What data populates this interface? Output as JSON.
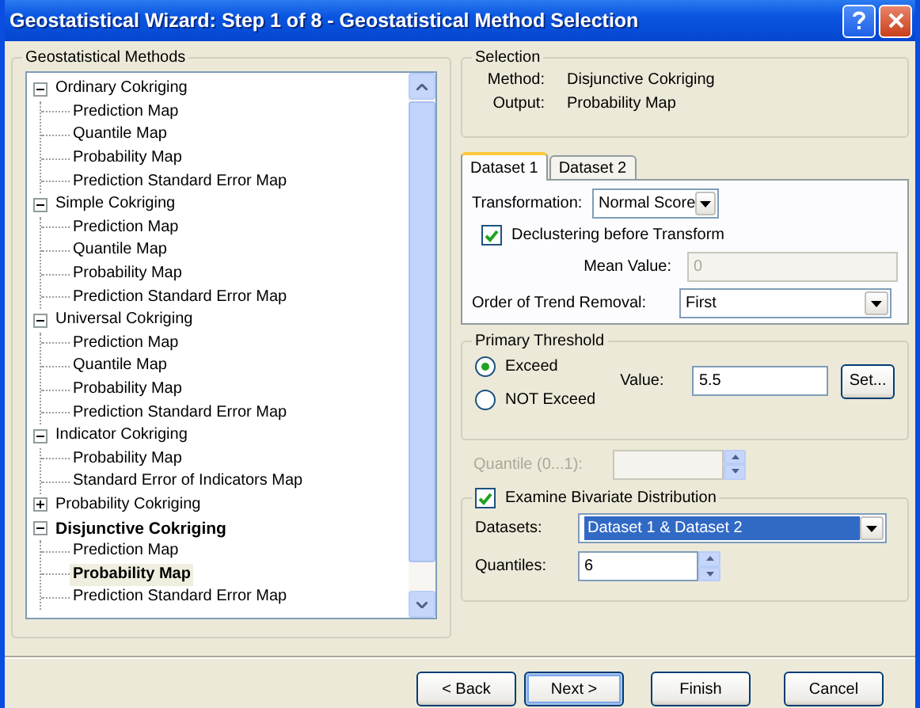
{
  "window": {
    "title": "Geostatistical Wizard: Step 1 of 8 - Geostatistical Method Selection"
  },
  "methods": {
    "title": "Geostatistical Methods",
    "tree": [
      {
        "label": "Ordinary Cokriging",
        "expanded": true,
        "selected": false,
        "children": [
          {
            "label": "Prediction Map",
            "selected": false
          },
          {
            "label": "Quantile Map",
            "selected": false
          },
          {
            "label": "Probability Map",
            "selected": false
          },
          {
            "label": "Prediction Standard Error Map",
            "selected": false
          }
        ]
      },
      {
        "label": "Simple Cokriging",
        "expanded": true,
        "selected": false,
        "children": [
          {
            "label": "Prediction Map",
            "selected": false
          },
          {
            "label": "Quantile Map",
            "selected": false
          },
          {
            "label": "Probability Map",
            "selected": false
          },
          {
            "label": "Prediction Standard Error Map",
            "selected": false
          }
        ]
      },
      {
        "label": "Universal Cokriging",
        "expanded": true,
        "selected": false,
        "children": [
          {
            "label": "Prediction Map",
            "selected": false
          },
          {
            "label": "Quantile Map",
            "selected": false
          },
          {
            "label": "Probability Map",
            "selected": false
          },
          {
            "label": "Prediction Standard Error Map",
            "selected": false
          }
        ]
      },
      {
        "label": "Indicator Cokriging",
        "expanded": true,
        "selected": false,
        "children": [
          {
            "label": "Probability Map",
            "selected": false
          },
          {
            "label": "Standard Error of Indicators Map",
            "selected": false
          }
        ]
      },
      {
        "label": "Probability Cokriging",
        "expanded": false,
        "selected": false
      },
      {
        "label": "Disjunctive Cokriging",
        "expanded": true,
        "selected": true,
        "children": [
          {
            "label": "Prediction Map",
            "selected": false
          },
          {
            "label": "Probability Map",
            "selected": true
          },
          {
            "label": "Prediction Standard Error Map",
            "selected": false
          }
        ]
      }
    ]
  },
  "selection": {
    "title": "Selection",
    "fields": [
      {
        "label": "Method:",
        "value": "Disjunctive Cokriging"
      },
      {
        "label": "Output:",
        "value": "Probability Map"
      }
    ]
  },
  "tabs": [
    {
      "label": "Dataset 1",
      "selected": true
    },
    {
      "label": "Dataset 2",
      "selected": false
    }
  ],
  "dataset": {
    "transformation": {
      "label": "Transformation:",
      "value": "Normal Score"
    },
    "declustering": {
      "label": "Declustering before Transform",
      "checked": true
    },
    "mean_value": {
      "label": "Mean Value:",
      "value": "0",
      "disabled": true
    },
    "trend_removal": {
      "label": "Order of Trend Removal:",
      "value": "First"
    }
  },
  "primary_threshold": {
    "title": "Primary Threshold",
    "options": [
      {
        "label": "Exceed",
        "selected": true
      },
      {
        "label": "NOT Exceed",
        "selected": false
      }
    ],
    "value_label": "Value:",
    "value": "5.5",
    "set_button": "Set..."
  },
  "quantile": {
    "label": "Quantile (0...1):",
    "disabled": true
  },
  "bivariate": {
    "label": "Examine Bivariate Distribution",
    "checked": true,
    "datasets_label": "Datasets:",
    "datasets": "Dataset 1 & Dataset 2",
    "quantiles_label": "Quantiles:",
    "quantiles": "6"
  },
  "buttons": [
    {
      "label": "< Back",
      "default": false
    },
    {
      "label": "Next >",
      "default": true
    },
    {
      "label": "Finish",
      "default": false
    },
    {
      "label": "Cancel",
      "default": false
    }
  ]
}
